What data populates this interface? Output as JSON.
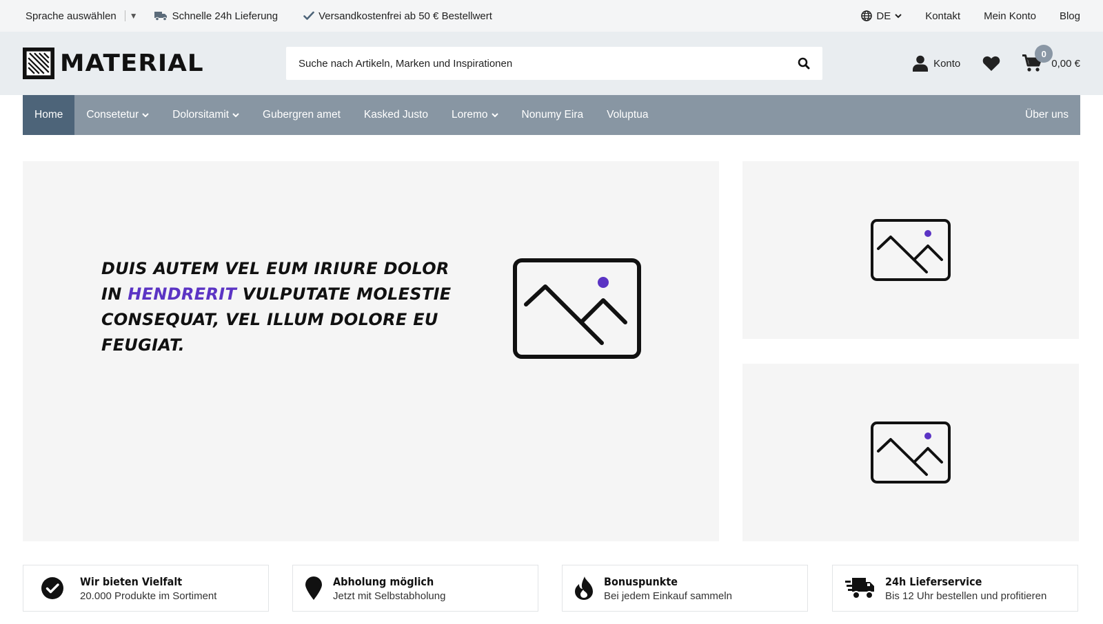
{
  "topbar": {
    "language_label": "Sprache auswählen",
    "language_arrow": "▼",
    "usp_delivery": "Schnelle 24h Lieferung",
    "usp_shipping": "Versandkostenfrei ab 50 € Bestellwert",
    "locale": "DE",
    "contact": "Kontakt",
    "account": "Mein Konto",
    "blog": "Blog"
  },
  "header": {
    "logo_text": "MATERIAL",
    "search_placeholder": "Suche nach Artikeln, Marken und Inspirationen",
    "account_label": "Konto",
    "cart_count": "0",
    "cart_total": "0,00 €"
  },
  "nav": {
    "items": [
      {
        "label": "Home"
      },
      {
        "label": "Consetetur"
      },
      {
        "label": "Dolorsitamit"
      },
      {
        "label": "Gubergren amet"
      },
      {
        "label": "Kasked Justo"
      },
      {
        "label": "Loremo"
      },
      {
        "label": "Nonumy Eira"
      },
      {
        "label": "Voluptua"
      }
    ],
    "about": "Über uns"
  },
  "hero": {
    "text_before": "DUIS AUTEM VEL EUM IRIURE DOLOR IN ",
    "text_highlight": "HENDRERIT",
    "text_after": " VULPUTATE MOLESTIE CONSEQUAT, VEL ILLUM DOLORE EU FEUGIAT."
  },
  "usps": [
    {
      "title": "Wir bieten Vielfalt",
      "subtitle": "20.000 Produkte im Sortiment",
      "icon": "check-circle-icon"
    },
    {
      "title": "Abholung möglich",
      "subtitle": "Jetzt mit Selbstabholung",
      "icon": "map-marker-icon"
    },
    {
      "title": "Bonuspunkte",
      "subtitle": "Bei jedem Einkauf sammeln",
      "icon": "flame-icon"
    },
    {
      "title": "24h Lieferservice",
      "subtitle": "Bis 12 Uhr bestellen und profitieren",
      "icon": "shipping-fast-icon"
    }
  ],
  "colors": {
    "accent": "#5b34c4",
    "nav_bg": "#8896a3",
    "nav_active": "#4d6479"
  }
}
